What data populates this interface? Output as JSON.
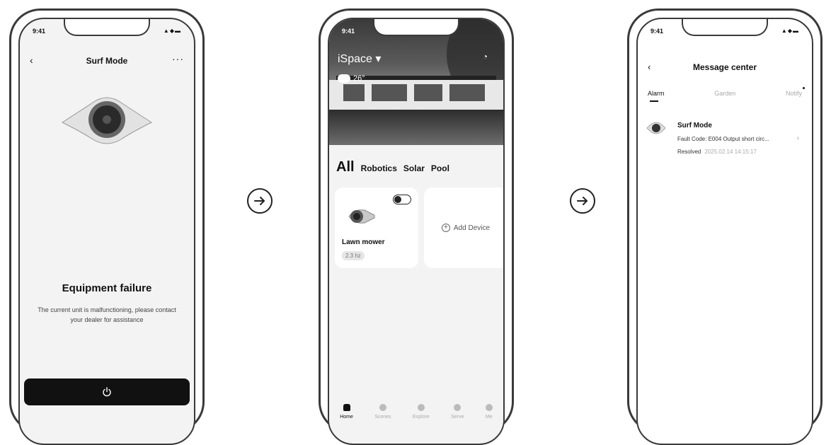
{
  "screen1": {
    "status_time": "9:41",
    "status_icons": "▲◆▬",
    "nav_title": "Surf Mode",
    "failure_title": "Equipment failure",
    "failure_description": "The current unit is malfunctioning, please contact your dealer for assistance"
  },
  "screen2": {
    "status_time": "9:41",
    "space_name": "iSpace ▾",
    "weather_temp": "26°",
    "tabs": {
      "all": "All",
      "robotics": "Robotics",
      "solar": "Solar",
      "pool": "Pool"
    },
    "device": {
      "name": "Lawn mower",
      "badge": "2.3 hz",
      "toggle_on": true
    },
    "add_device_label": "Add Device",
    "bottom_nav": [
      "Home",
      "Scenes",
      "Explore",
      "Serve",
      "Me"
    ]
  },
  "screen3": {
    "status_time": "9:41",
    "status_icons": "▲◆▬",
    "nav_title": "Message center",
    "tabs": [
      "Alarm",
      "Garden",
      "Notify"
    ],
    "message": {
      "title": "Surf Mode",
      "fault": "Fault Code: E004 Output short circ...",
      "status": "Resolved",
      "time": "2025.02.14 14:15:17"
    }
  },
  "colors": {
    "dark": "#111111",
    "frame": "#3a3a3a",
    "screen_bg": "#f3f3f3"
  }
}
